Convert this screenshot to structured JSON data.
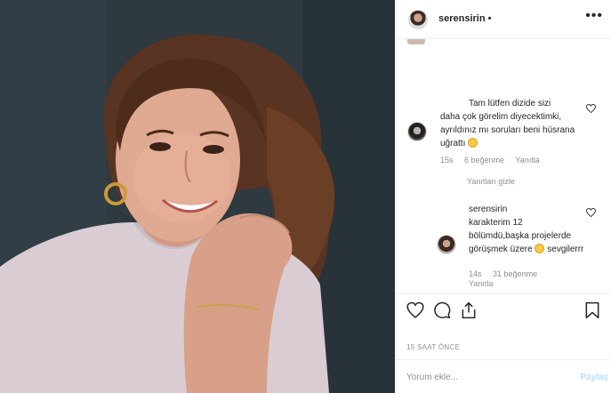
{
  "header": {
    "username": "serensirin",
    "dot": "•",
    "more": "•••"
  },
  "comments": [
    {
      "line1": "Tam lütfen dizide sizi",
      "rest": "daha çok görelim diyecektimki, ayrıldınız mı soruları beni hüsrana uğrattı",
      "time": "15s",
      "likes": "6 beğenme",
      "reply": "Yanıtla"
    }
  ],
  "hide_replies": "Yanıtları gizle",
  "reply": {
    "username": "serensirin",
    "text": "karakterim 12 bölümdü,başka projelerde görüşmek üzere",
    "text_end": "sevgilerrr",
    "time": "14s",
    "likes": "31 beğenme",
    "reply": "Yanıtla"
  },
  "icons": [
    "heart-icon",
    "comment-icon",
    "share-icon",
    "bookmark-icon",
    "more-icon"
  ],
  "timestamp": "15 SAAT ÖNCE",
  "add_comment": {
    "placeholder": "Yorum ekle...",
    "post": "Paylaş"
  },
  "colors": {
    "accent": "#0095f6",
    "muted": "#8e8e8e",
    "border": "#efefef"
  }
}
